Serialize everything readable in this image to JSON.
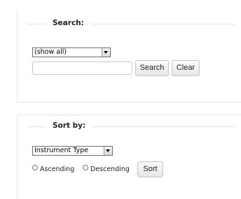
{
  "search": {
    "legend": "Search:",
    "filter_selected": "(show all)",
    "query_value": "",
    "search_label": "Search",
    "clear_label": "Clear"
  },
  "sort": {
    "legend": "Sort by:",
    "field_selected": "Instrument Type",
    "ascending_label": "Ascending",
    "descending_label": "Descending",
    "sort_label": "Sort"
  }
}
